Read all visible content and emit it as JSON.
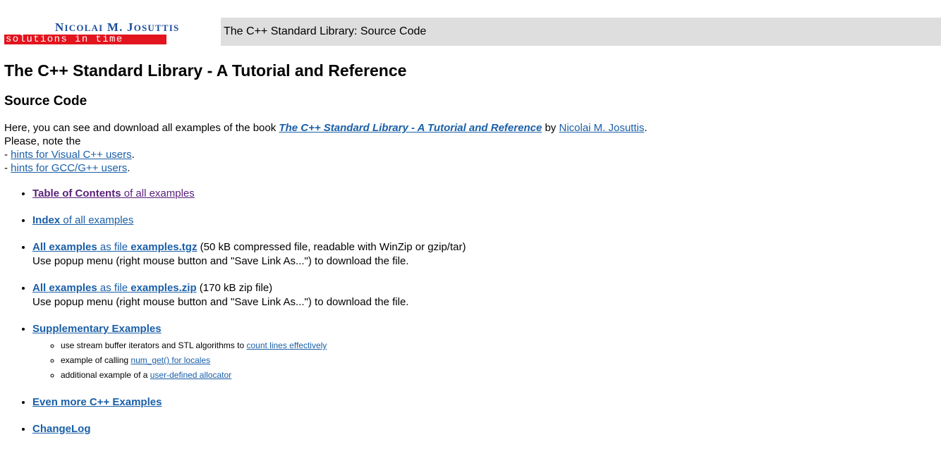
{
  "header": {
    "logo": {
      "name_initial_1": "N",
      "name_rest_1": "ICOLAI",
      "name_initial_2": "M. J",
      "name_rest_2": "OSUTTIS",
      "tagline": "solutions in time",
      "brand_color": "#1e4f9c",
      "bar_color": "#e2141e"
    },
    "title": "The C++ Standard Library: Source Code",
    "title_bar_color": "#dedede"
  },
  "main": {
    "heading": "The C++ Standard Library - A Tutorial and Reference",
    "subheading": "Source Code",
    "intro": {
      "line1_prefix": "Here, you can see and download all examples of the book ",
      "book_link": "The C++ Standard Library - A Tutorial and Reference",
      "line1_by": " by ",
      "author_link": "Nicolai M. Josuttis",
      "line1_suffix": ".",
      "line2": "Please, note the",
      "hint1_prefix": "- ",
      "hint1_link": "hints for Visual C++ users",
      "hint1_suffix": ".",
      "hint2_prefix": "- ",
      "hint2_link": "hints for GCC/G++ users",
      "hint2_suffix": "."
    },
    "items": [
      {
        "bold": "Table of Contents",
        "rest": " of all examples",
        "visited": true
      },
      {
        "bold": "Index",
        "rest": " of all examples"
      },
      {
        "bold": "All examples",
        "mid": " as file ",
        "file": "examples.tgz",
        "after": " (50 kB compressed file, readable with WinZip or gzip/tar)",
        "note": "Use popup menu (right mouse button and \"Save Link As...\") to download the file."
      },
      {
        "bold": "All examples",
        "mid": " as file ",
        "file": "examples.zip",
        "after": " (170 kB zip file)",
        "note": "Use popup menu (right mouse button and \"Save Link As...\") to download the file."
      },
      {
        "bold": "Supplementary Examples",
        "sub": [
          {
            "text": "use stream buffer iterators and STL algorithms to ",
            "link": "count lines effectively"
          },
          {
            "text": "example of calling ",
            "link": "num_get() for locales"
          },
          {
            "text": "additional example of a ",
            "link": "user-defined allocator"
          }
        ]
      },
      {
        "bold": "Even more C++ Examples"
      },
      {
        "bold": "ChangeLog"
      }
    ],
    "link_color": "#1a5fa8",
    "visited_link_color": "#5a1f7a"
  }
}
